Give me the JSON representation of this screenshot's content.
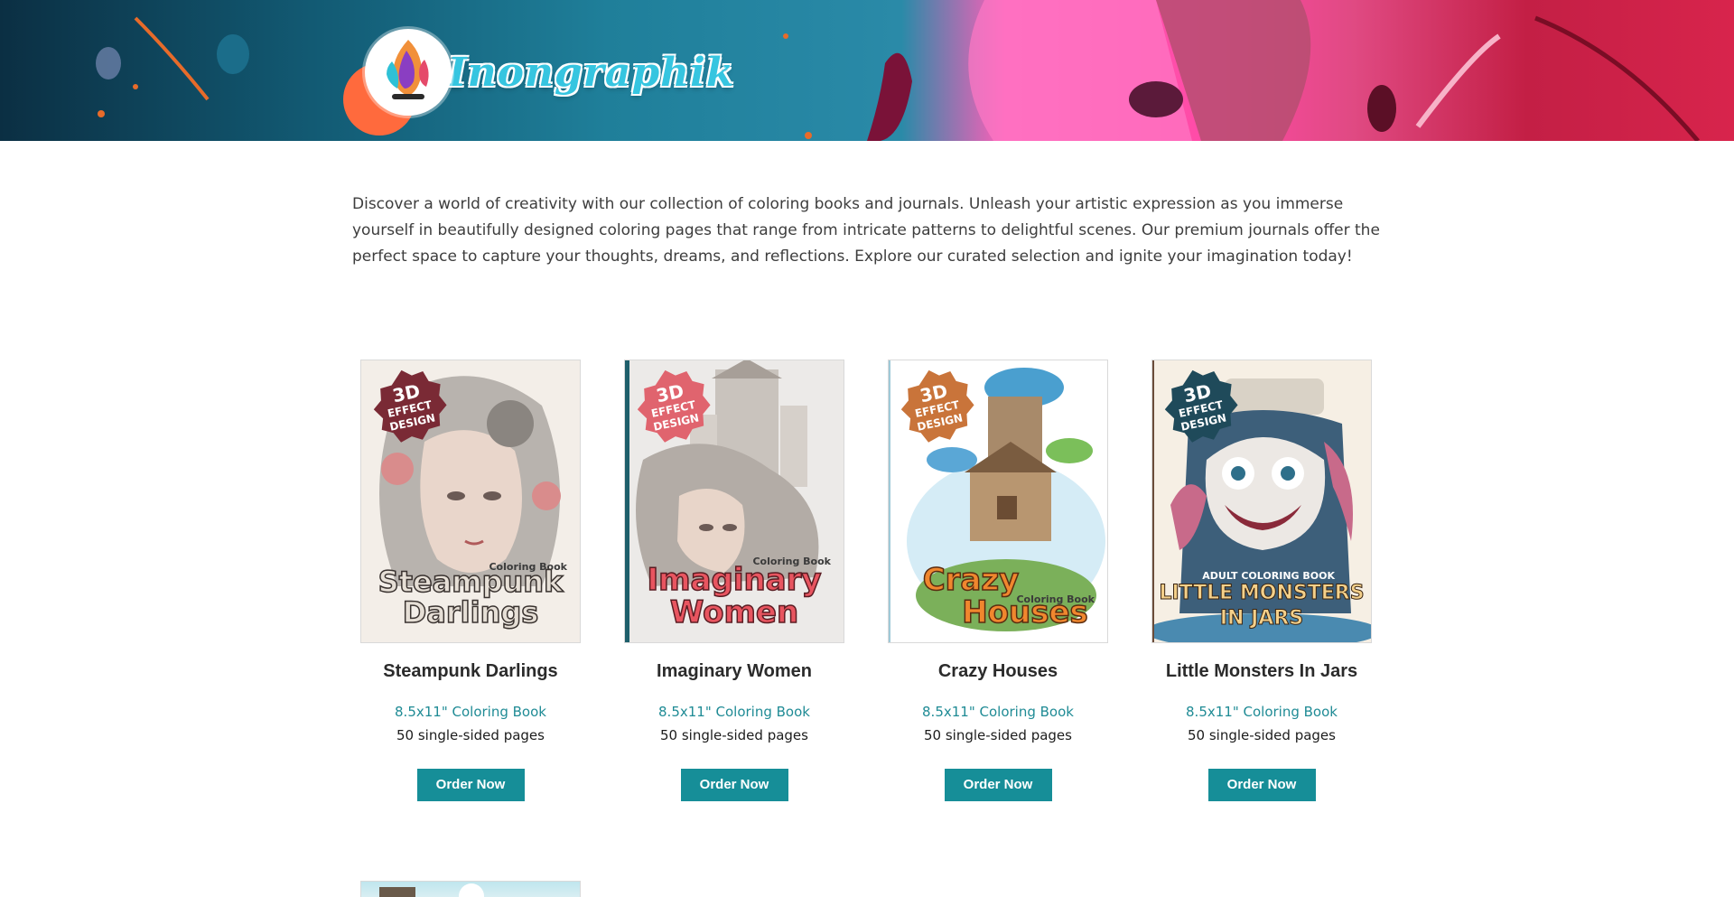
{
  "brand": {
    "logo_text": "Inongraphik",
    "colors": {
      "accent": "#168e98",
      "link": "#1f8b95",
      "banner_teal": "#1f7f9a",
      "banner_pink": "#ff5fb8",
      "banner_red": "#c31f45"
    }
  },
  "intro": {
    "text": "Discover a world of creativity with our collection of coloring books and journals. Unleash your artistic expression as you immerse yourself in beautifully designed coloring pages that range from intricate patterns to delightful scenes. Our premium journals offer the perfect space to capture your thoughts, dreams, and reflections. Explore our curated selection and ignite your imagination today!"
  },
  "badge": {
    "line1": "3D",
    "line2": "EFFECT",
    "line3": "DESIGN"
  },
  "products": [
    {
      "title": "Steampunk Darlings",
      "cover_title_1": "Steampunk",
      "cover_title_2": "Darlings",
      "cover_sub": "Coloring Book",
      "format": "8.5x11\" Coloring Book",
      "pages": "50 single-sided pages",
      "button": "Order Now",
      "badge_color": "#7a2a35"
    },
    {
      "title": "Imaginary Women",
      "cover_title_1": "Imaginary",
      "cover_title_2": "Women",
      "cover_sub": "Coloring Book",
      "format": "8.5x11\" Coloring Book",
      "pages": "50 single-sided pages",
      "button": "Order Now",
      "badge_color": "#e0646e"
    },
    {
      "title": "Crazy Houses",
      "cover_title_1": "Crazy",
      "cover_title_2": "Houses",
      "cover_sub": "Coloring Book",
      "format": "8.5x11\" Coloring Book",
      "pages": "50 single-sided pages",
      "button": "Order Now",
      "badge_color": "#c9743a"
    },
    {
      "title": "Little Monsters In Jars",
      "cover_title_1": "LITTLE MONSTERS",
      "cover_title_2": "IN JARS",
      "cover_sub": "ADULT COLORING BOOK",
      "format": "8.5x11\" Coloring Book",
      "pages": "50 single-sided pages",
      "button": "Order Now",
      "badge_color": "#1f4a5a"
    }
  ]
}
